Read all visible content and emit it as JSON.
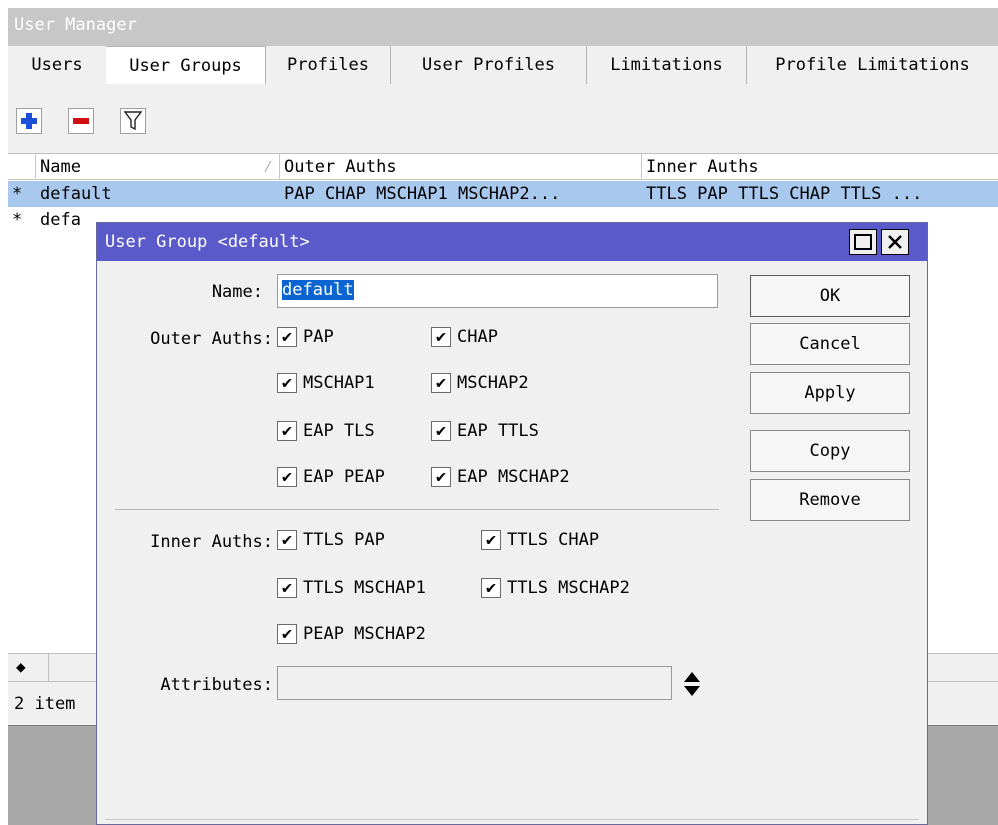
{
  "window": {
    "title": "User Manager"
  },
  "tabs": [
    "Users",
    "User Groups",
    "Profiles",
    "User Profiles",
    "Limitations",
    "Profile Limitations"
  ],
  "active_tab": "User Groups",
  "toolbar": {
    "add_icon": "plus-icon",
    "remove_icon": "minus-icon",
    "filter_icon": "filter-icon"
  },
  "table": {
    "columns": [
      "Name",
      "Outer Auths",
      "Inner Auths"
    ],
    "rows": [
      {
        "flag": "*",
        "name": "default",
        "outer": "PAP CHAP MSCHAP1 MSCHAP2...",
        "inner": "TTLS PAP TTLS CHAP TTLS ..."
      },
      {
        "flag": "*",
        "name": "defa"
      }
    ]
  },
  "status": {
    "count": "2 item"
  },
  "dialog": {
    "title": "User Group <default>",
    "name_label": "Name:",
    "name_value": "default",
    "outer_label": "Outer Auths:",
    "outer_auths": [
      {
        "label": "PAP",
        "checked": true
      },
      {
        "label": "CHAP",
        "checked": true
      },
      {
        "label": "MSCHAP1",
        "checked": true
      },
      {
        "label": "MSCHAP2",
        "checked": true
      },
      {
        "label": "EAP TLS",
        "checked": true
      },
      {
        "label": "EAP TTLS",
        "checked": true
      },
      {
        "label": "EAP PEAP",
        "checked": true
      },
      {
        "label": "EAP MSCHAP2",
        "checked": true
      }
    ],
    "inner_label": "Inner Auths:",
    "inner_auths": [
      {
        "label": "TTLS PAP",
        "checked": true
      },
      {
        "label": "TTLS CHAP",
        "checked": true
      },
      {
        "label": "TTLS MSCHAP1",
        "checked": true
      },
      {
        "label": "TTLS MSCHAP2",
        "checked": true
      },
      {
        "label": "PEAP MSCHAP2",
        "checked": true
      }
    ],
    "attributes_label": "Attributes:",
    "attributes_value": "",
    "buttons": {
      "ok": "OK",
      "cancel": "Cancel",
      "apply": "Apply",
      "copy": "Copy",
      "remove": "Remove"
    }
  },
  "colors": {
    "dialog_title": "#5a5acb",
    "selection": "#a8c8ee",
    "plus": "#1e4fd8",
    "minus": "#d01010"
  }
}
